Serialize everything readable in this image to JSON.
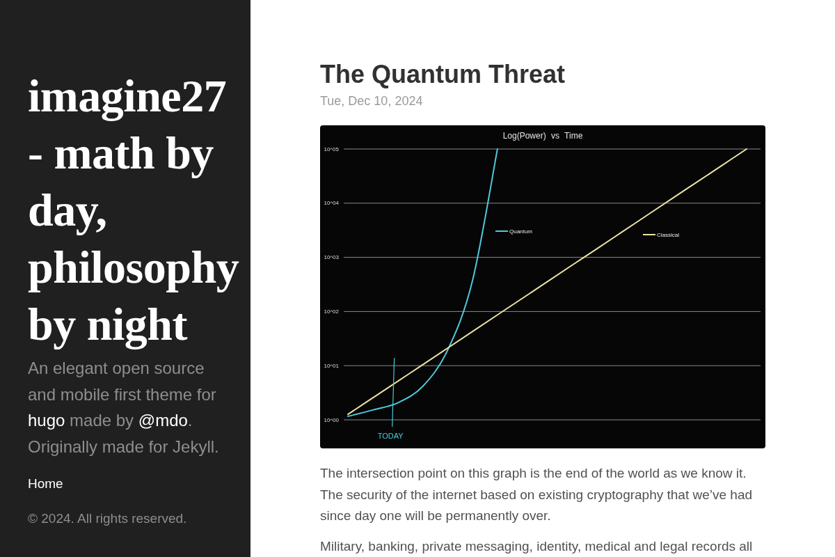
{
  "sidebar": {
    "title": "imagine27 - math by day, philosophy by night",
    "description": [
      {
        "kind": "text",
        "text": "An elegant open source and mobile first theme for "
      },
      {
        "kind": "link",
        "text": "hugo"
      },
      {
        "kind": "text",
        "text": " made by "
      },
      {
        "kind": "link",
        "text": "@mdo"
      },
      {
        "kind": "text",
        "text": ". Originally made for Jekyll."
      }
    ],
    "nav": [
      {
        "label": "Home"
      }
    ],
    "copyright": "© 2024. All rights reserved."
  },
  "post": {
    "title": "The Quantum Threat",
    "date": "Tue, Dec 10, 2024",
    "chart_data": [
      {
        "type": "line",
        "title": "Log(Power) vs Time",
        "categories": [
          null,
          null,
          null,
          null,
          null,
          null,
          null,
          null,
          null,
          null,
          null,
          null,
          null,
          null,
          null,
          null,
          null
        ],
        "log": "y",
        "ylim": [
          1,
          100000
        ],
        "yticks": [
          {
            "value": 1,
            "label": "10^00"
          },
          {
            "value": 10,
            "label": "10^01"
          },
          {
            "value": 100,
            "label": "10^02"
          },
          {
            "value": 1000,
            "label": "10^03"
          },
          {
            "value": 10000,
            "label": "10^04"
          },
          {
            "value": 100000,
            "label": "10^05"
          }
        ],
        "tick_labels": "y",
        "grid": true,
        "legend": "top right",
        "series": [
          {
            "name": "Quantum",
            "color": "#4ec9dd",
            "values": [
              1.16,
              1.52,
              2.06,
              4.14,
              19.3,
              372,
              100000,
              null,
              null,
              null,
              null,
              null,
              null,
              null,
              null,
              null,
              null
            ]
          },
          {
            "name": "Classical",
            "color": "#ebe3a3",
            "values": [
              1.26,
              2.55,
              5.16,
              10.4,
              21.1,
              42.8,
              86.6,
              175,
              355,
              718,
              1450,
              2940,
              5960,
              12100,
              24400,
              49400,
              100000
            ]
          }
        ],
        "annotations": [
          "TODAY"
        ]
      }
    ],
    "paragraphs": [
      "The intersection point on this graph is the end of the world as we know it. The security of the internet based on existing cryptography that we’ve had since day one will be permanently over.",
      "Military, banking, private messaging, identity, medical and legal records all"
    ]
  }
}
